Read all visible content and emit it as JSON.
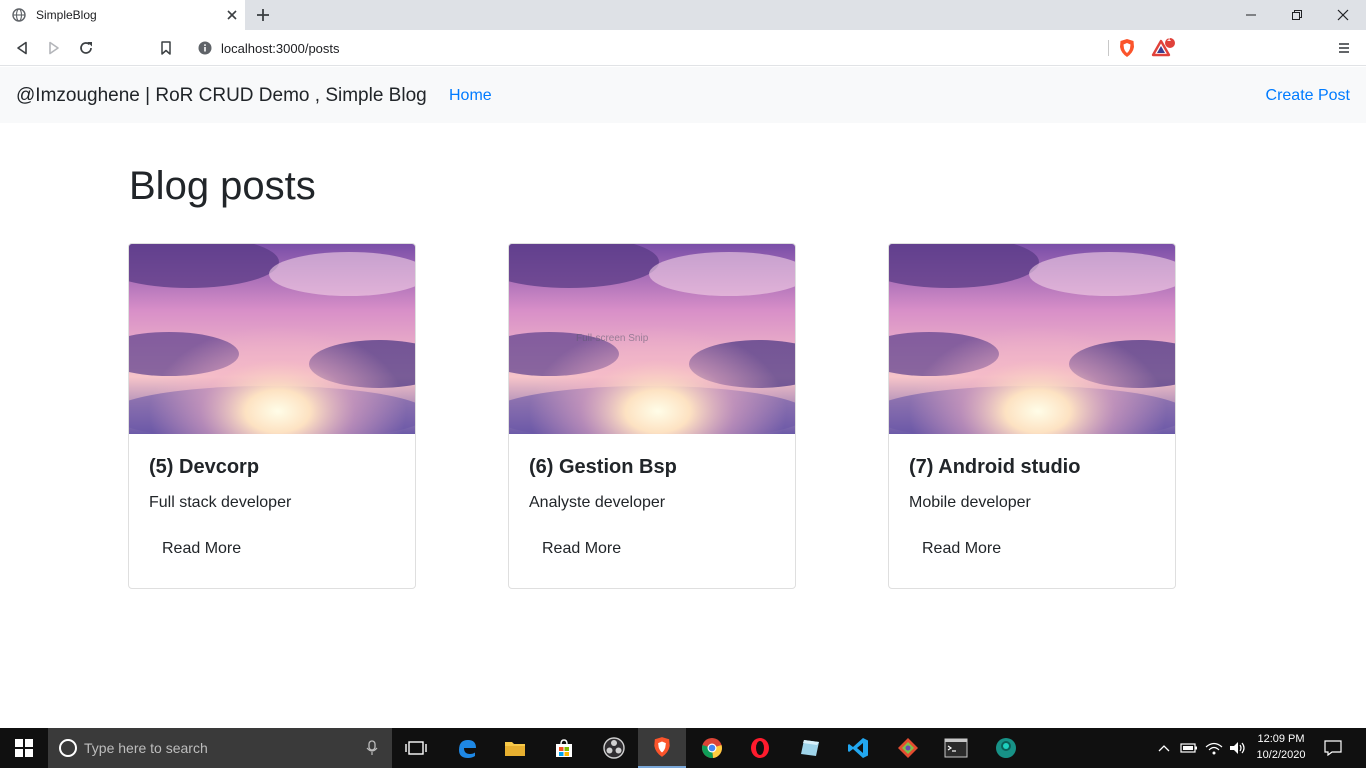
{
  "browser": {
    "tab_title": "SimpleBlog",
    "url": "localhost:3000/posts",
    "extension_badge": "1"
  },
  "navbar": {
    "brand": "@Imzoughene | RoR CRUD Demo , Simple Blog",
    "home": "Home",
    "create_post": "Create Post"
  },
  "page": {
    "title": "Blog posts"
  },
  "posts": [
    {
      "title": "(5) Devcorp",
      "description": "Full stack developer",
      "button": "Read More"
    },
    {
      "title": "(6) Gestion Bsp",
      "description": "Analyste developer",
      "button": "Read More"
    },
    {
      "title": "(7) Android studio",
      "description": "Mobile developer",
      "button": "Read More"
    }
  ],
  "overlay_text": "Full-screen Snip",
  "taskbar": {
    "search_placeholder": "Type here to search",
    "time": "12:09 PM",
    "date": "10/2/2020"
  },
  "colors": {
    "link": "#007bff",
    "navbar_bg": "#f8f9fa",
    "taskbar_bg": "#101010",
    "brave_orange": "#fb542b"
  }
}
